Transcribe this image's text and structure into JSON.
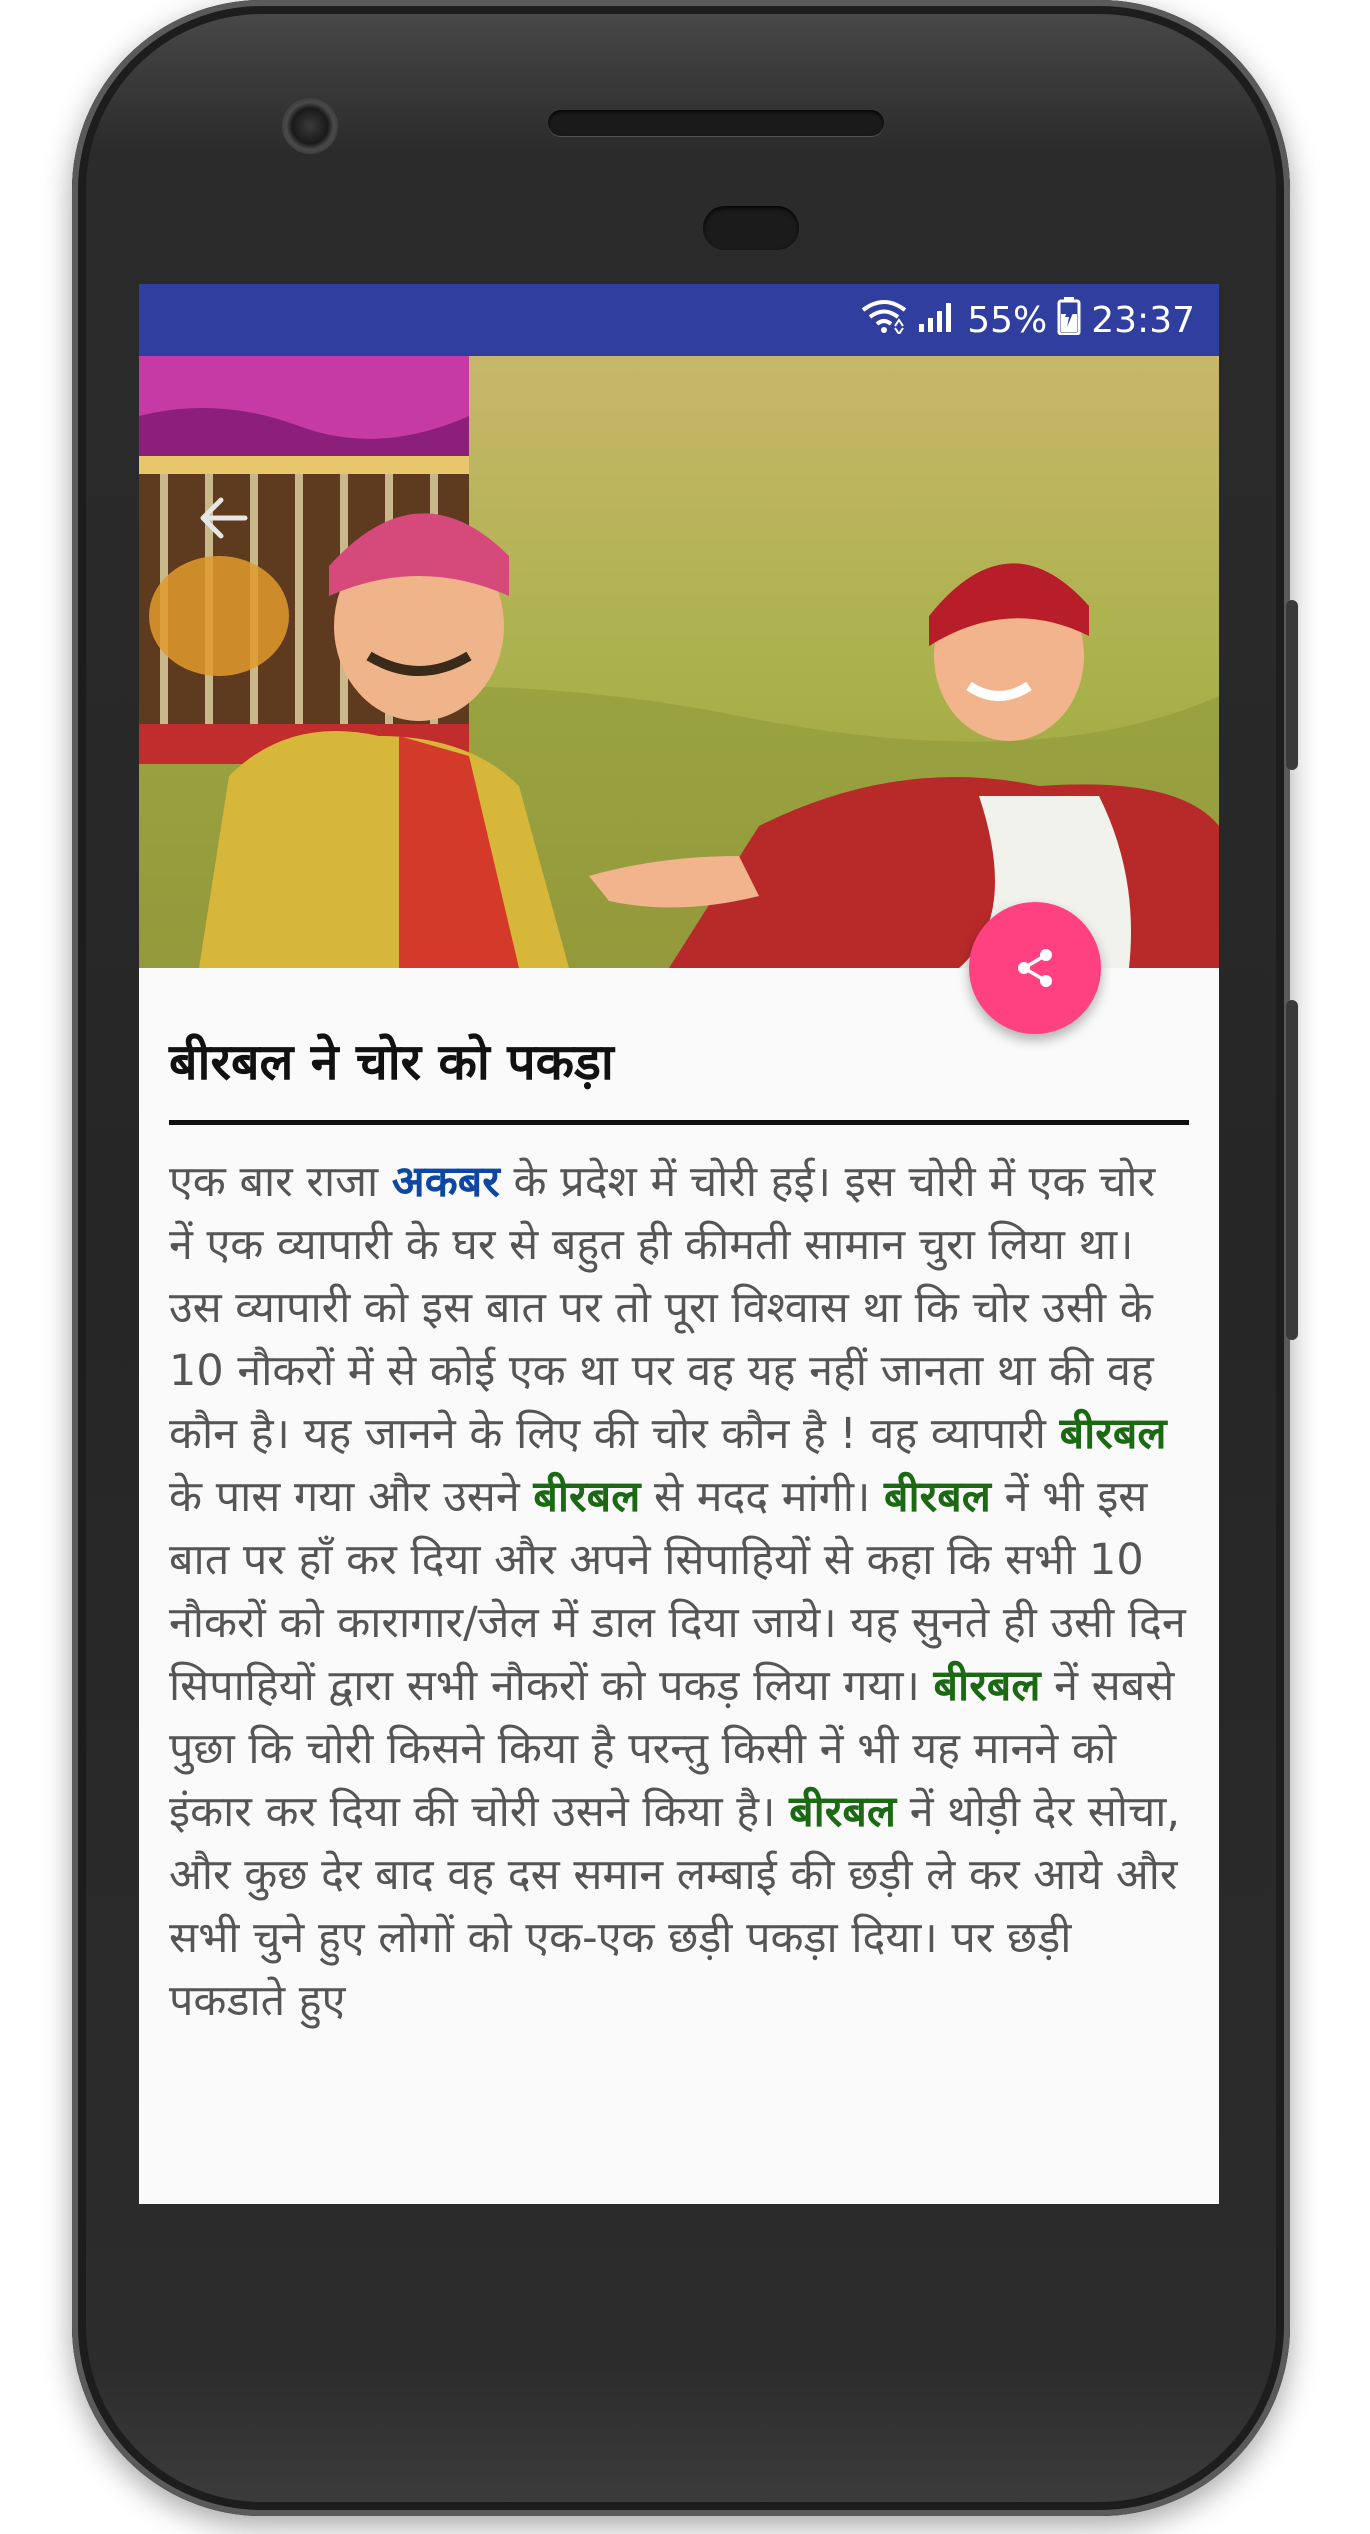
{
  "status_bar": {
    "battery": "55%",
    "time": "23:37",
    "icons": [
      "wifi-icon",
      "signal-icon",
      "battery-icon"
    ]
  },
  "header": {
    "back_icon": "arrow-left-icon",
    "share_icon": "share-icon"
  },
  "story": {
    "title": "बीरबल ने चोर को पकड़ा",
    "segments": [
      {
        "text": "एक बार राजा ",
        "style": "normal"
      },
      {
        "text": "अकबर",
        "style": "blue"
      },
      {
        "text": " के प्रदेश में चोरी हई। इस चोरी में एक चोर नें एक व्यापारी के घर से बहुत ही कीमती सामान चुरा लिया था। उस व्यापारी को इस बात पर तो पूरा विश्वास था कि चोर उसी के 10 नौकरों में से कोई एक था पर वह यह नहीं जानता था की वह कौन है। यह जानने के लिए की चोर कौन है ! वह व्यापारी ",
        "style": "normal"
      },
      {
        "text": "बीरबल",
        "style": "green"
      },
      {
        "text": " के पास गया और उसने ",
        "style": "normal"
      },
      {
        "text": "बीरबल",
        "style": "green"
      },
      {
        "text": " से मदद मांगी। ",
        "style": "normal"
      },
      {
        "text": "बीरबल",
        "style": "green"
      },
      {
        "text": " नें भी इस बात पर हाँ कर दिया और अपने सिपाहियों से कहा कि सभी 10 नौकरों को कारागार/जेल में डाल दिया जाये। यह सुनते ही उसी दिन सिपाहियों द्वारा सभी नौकरों को पकड़ लिया गया। ",
        "style": "normal"
      },
      {
        "text": "बीरबल",
        "style": "green"
      },
      {
        "text": " नें सबसे पुछा कि चोरी किसने किया है परन्तु किसी नें भी यह मानने को इंकार कर दिया की चोरी उसने किया है। ",
        "style": "normal"
      },
      {
        "text": "बीरबल",
        "style": "green"
      },
      {
        "text": " नें थोड़ी देर सोचा, और कुछ देर बाद वह दस समान लम्बाई की छड़ी ले कर आये और सभी चुने हुए लोगों को एक-एक छड़ी पकड़ा दिया। पर छड़ी पकडाते हुए ",
        "style": "normal"
      }
    ]
  },
  "colors": {
    "status_bar": "#303f9f",
    "fab": "#ff4081",
    "highlight_blue": "#0d47a1",
    "highlight_green": "#1b6a13",
    "body_text": "#555555"
  }
}
